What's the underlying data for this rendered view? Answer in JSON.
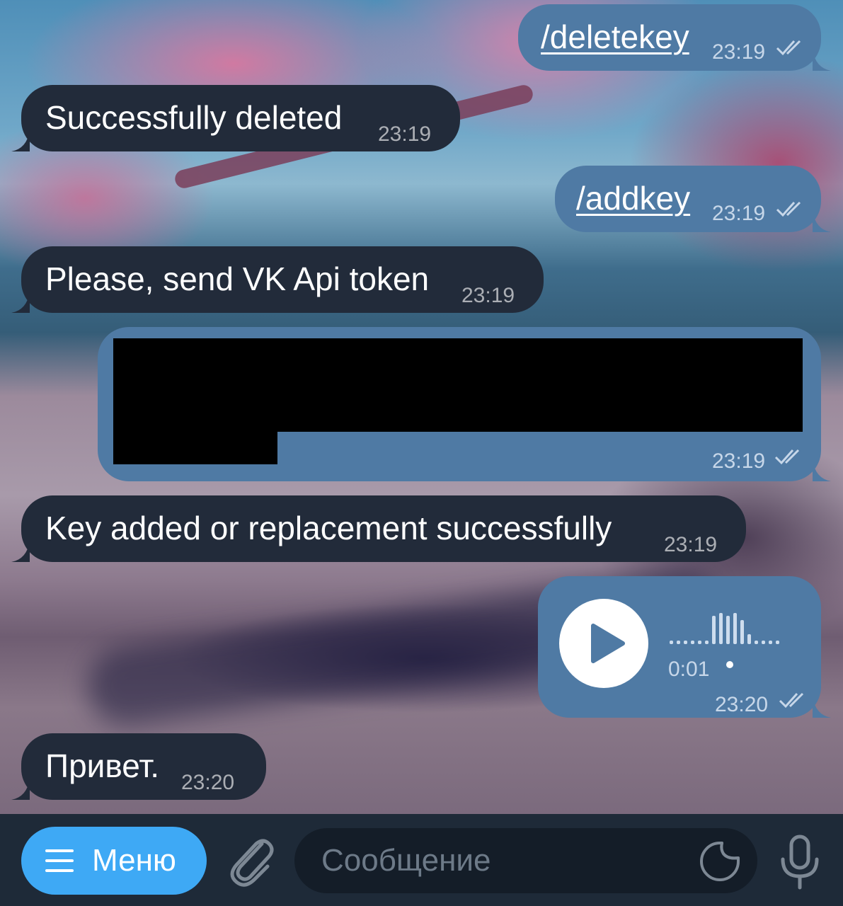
{
  "messages": [
    {
      "side": "out",
      "text": "/deletekey",
      "time": "23:19",
      "read": true,
      "is_command": true
    },
    {
      "side": "in",
      "text": "Successfully deleted",
      "time": "23:19"
    },
    {
      "side": "out",
      "text": "/addkey",
      "time": "23:19",
      "read": true,
      "is_command": true
    },
    {
      "side": "in",
      "text": "Please, send VK Api token",
      "time": "23:19"
    },
    {
      "side": "out",
      "type": "redacted-token",
      "time": "23:19",
      "read": true
    },
    {
      "side": "in",
      "text": "Key added or replacement successfully",
      "time": "23:19"
    },
    {
      "side": "out",
      "type": "voice",
      "duration": "0:01",
      "time": "23:20",
      "read": true
    },
    {
      "side": "in",
      "text": "Привет.",
      "time": "23:20"
    }
  ],
  "bottom_bar": {
    "menu_label": "Меню",
    "input_placeholder": "Сообщение"
  },
  "colors": {
    "incoming_bubble": "#222b3a",
    "outgoing_bubble": "#4f7aa4",
    "menu_button": "#3ea9f5",
    "bottom_bar": "#1e2a38",
    "input_bg": "#141d28"
  },
  "icons": [
    "burger-menu-icon",
    "paperclip-icon",
    "sticker-icon",
    "microphone-icon",
    "play-icon",
    "double-check-icon"
  ]
}
